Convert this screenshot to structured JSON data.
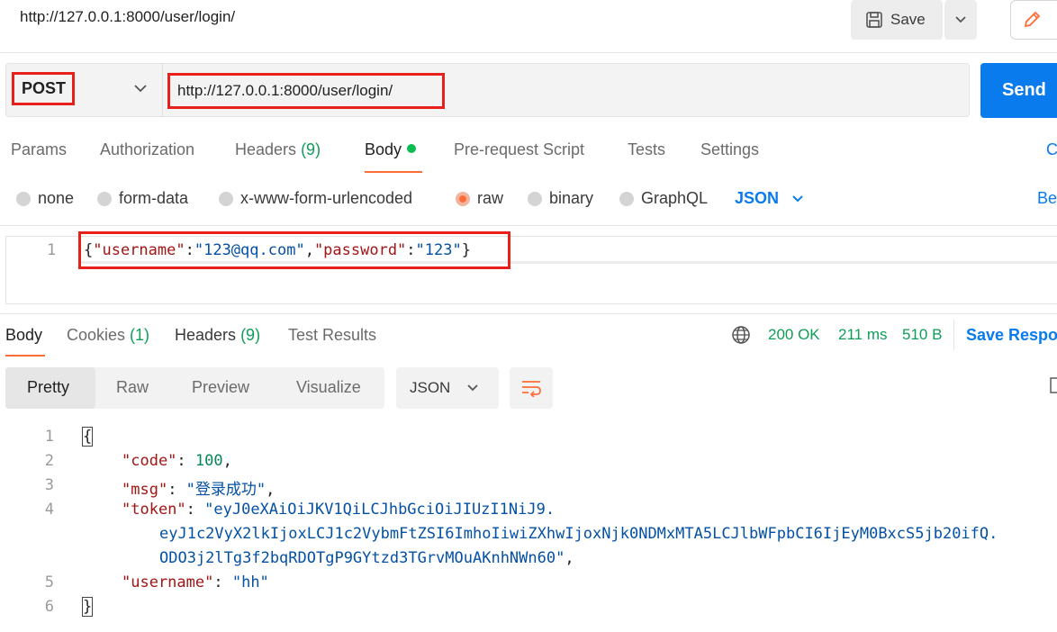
{
  "top": {
    "title_url": "http://127.0.0.1:8000/user/login/",
    "save_label": "Save"
  },
  "request": {
    "method": "POST",
    "url": "http://127.0.0.1:8000/user/login/",
    "send_label": "Send"
  },
  "request_tabs": [
    {
      "label": "Params"
    },
    {
      "label": "Authorization"
    },
    {
      "label": "Headers",
      "count": "(9)"
    },
    {
      "label": "Body",
      "active": true
    },
    {
      "label": "Pre-request Script"
    },
    {
      "label": "Tests"
    },
    {
      "label": "Settings"
    }
  ],
  "cut_off": {
    "tab_right": "C",
    "radio_right": "Be",
    "save_response": "Save Respo"
  },
  "body_types": {
    "none": "none",
    "form_data": "form-data",
    "urlencoded": "x-www-form-urlencoded",
    "raw": "raw",
    "binary": "binary",
    "graphql": "GraphQL",
    "format": "JSON",
    "selected": "raw"
  },
  "request_body": {
    "line_number": "1",
    "open": "{",
    "key1": "\"username\"",
    "colon": ":",
    "val1": "\"123@qq.com\"",
    "comma": ",",
    "key2": "\"password\"",
    "val2": "\"123\"",
    "close": "}"
  },
  "response_tabs": {
    "body": "Body",
    "cookies": "Cookies",
    "cookies_count": "(1)",
    "headers": "Headers",
    "headers_count": "(9)",
    "test_results": "Test Results"
  },
  "response_status": {
    "status": "200 OK",
    "time": "211 ms",
    "size": "510 B"
  },
  "view_modes": {
    "pretty": "Pretty",
    "raw": "Raw",
    "preview": "Preview",
    "visualize": "Visualize",
    "format": "JSON"
  },
  "response_body": {
    "line_numbers": [
      "1",
      "2",
      "3",
      "4",
      "5",
      "6"
    ],
    "open": "{",
    "code_key": "\"code\"",
    "code_val": "100",
    "msg_key": "\"msg\"",
    "msg_val": "\"登录成功\"",
    "token_key": "\"token\"",
    "token_line1": "\"eyJ0eXAiOiJKV1QiLCJhbGciOiJIUzI1NiJ9.",
    "token_line2": "eyJ1c2VyX2lkIjoxLCJ1c2VybmFtZSI6ImhoIiwiZXhwIjoxNjk0NDMxMTA5LCJlbWFpbCI6IjEyM0BxcS5jb20ifQ.",
    "token_line3": "ODO3j2lTg3f2bqRDOTgP9GYtzd3TGrvMOuAKnhNWn60\"",
    "username_key": "\"username\"",
    "username_val": "\"hh\"",
    "close": "}"
  }
}
